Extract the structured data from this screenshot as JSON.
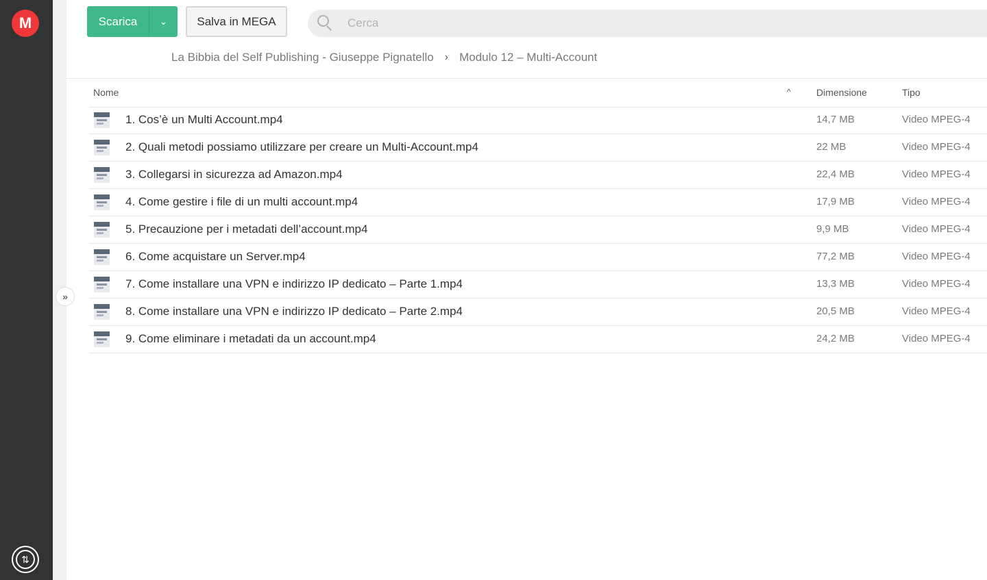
{
  "app": {
    "logo_letter": "M"
  },
  "toolbar": {
    "download_label": "Scarica",
    "save_label": "Salva in MEGA"
  },
  "search": {
    "placeholder": "Cerca"
  },
  "breadcrumb": {
    "items": [
      "La Bibbia del Self Publishing - Giuseppe Pignatello",
      "Modulo 12 – Multi-Account"
    ]
  },
  "table": {
    "headers": {
      "name": "Nome",
      "size": "Dimensione",
      "type": "Tipo"
    },
    "rows": [
      {
        "name": "1. Cos’è un Multi Account.mp4",
        "size": "14,7 MB",
        "type": "Video MPEG-4"
      },
      {
        "name": "2. Quali metodi possiamo utilizzare per creare un Multi-Account.mp4",
        "size": "22 MB",
        "type": "Video MPEG-4"
      },
      {
        "name": "3. Collegarsi in sicurezza ad Amazon.mp4",
        "size": "22,4 MB",
        "type": "Video MPEG-4"
      },
      {
        "name": "4. Come gestire i file di un multi account.mp4",
        "size": "17,9 MB",
        "type": "Video MPEG-4"
      },
      {
        "name": "5. Precauzione per i metadati dell’account.mp4",
        "size": "9,9 MB",
        "type": "Video MPEG-4"
      },
      {
        "name": "6. Come acquistare un Server.mp4",
        "size": "77,2 MB",
        "type": "Video MPEG-4"
      },
      {
        "name": "7. Come installare una VPN e indirizzo IP dedicato – Parte 1.mp4",
        "size": "13,3 MB",
        "type": "Video MPEG-4"
      },
      {
        "name": "8. Come installare una VPN e indirizzo IP dedicato – Parte 2.mp4",
        "size": "20,5 MB",
        "type": "Video MPEG-4"
      },
      {
        "name": "9. Come eliminare i metadati da un account.mp4",
        "size": "24,2 MB",
        "type": "Video MPEG-4"
      }
    ]
  },
  "colors": {
    "accent": "#3fb98b",
    "brand": "#f0373a",
    "rail": "#333333"
  },
  "icons": {
    "logo": "mega-logo-icon",
    "transfers": "transfers-icon",
    "expand": "expand-sidebar-icon",
    "search": "search-icon",
    "sort": "sort-asc-icon"
  }
}
